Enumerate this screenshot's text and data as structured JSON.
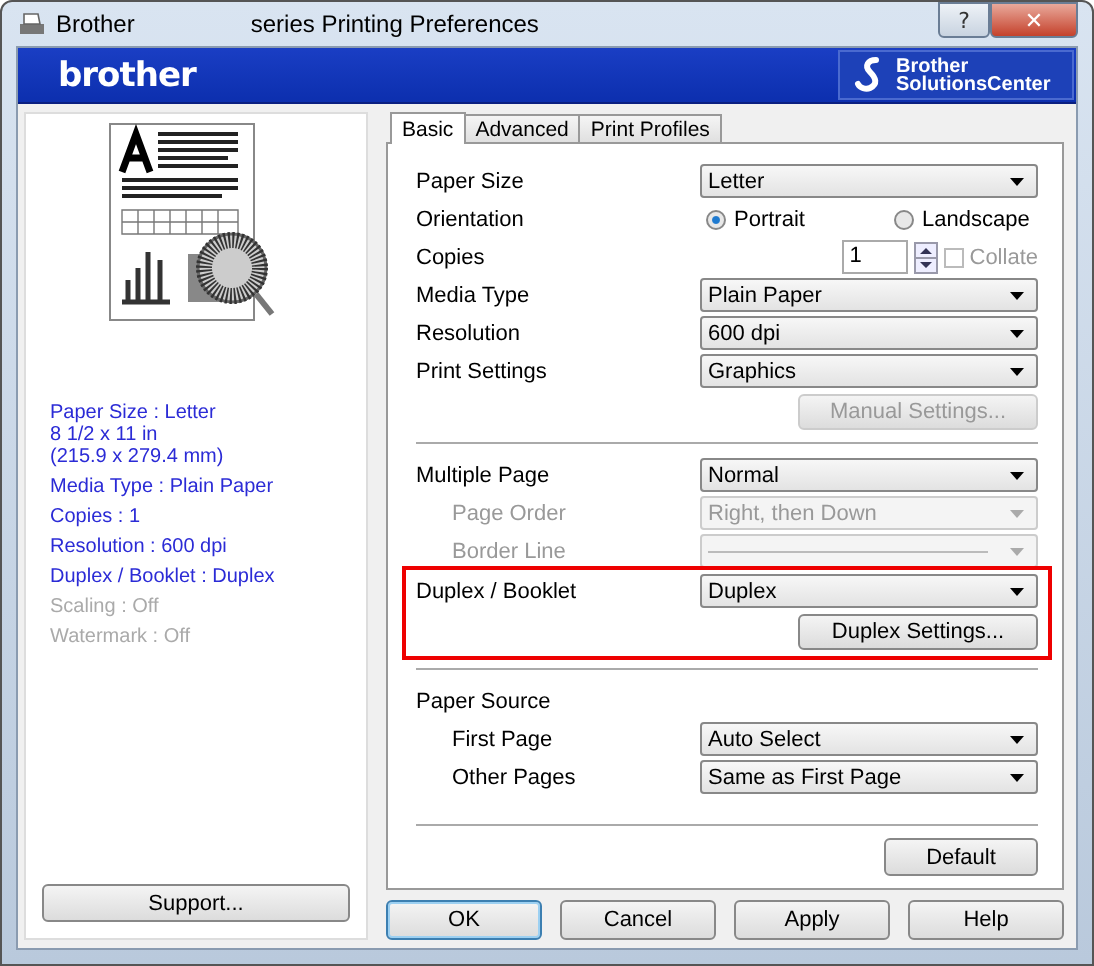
{
  "window": {
    "title_start": "Brother",
    "title_end": "series Printing Preferences",
    "help_glyph": "?",
    "close_glyph": "✕"
  },
  "banner": {
    "logo": "brother",
    "solutions_lines": [
      "Brother",
      "SolutionsCenter"
    ]
  },
  "summary": [
    {
      "lines": [
        "Paper Size : Letter",
        "8 1/2 x 11 in",
        "(215.9 x 279.4 mm)"
      ],
      "disabled": false
    },
    {
      "lines": [
        "Media Type : Plain Paper"
      ],
      "disabled": false
    },
    {
      "lines": [
        "Copies : 1"
      ],
      "disabled": false
    },
    {
      "lines": [
        "Resolution : 600 dpi"
      ],
      "disabled": false
    },
    {
      "lines": [
        "Duplex / Booklet : Duplex"
      ],
      "disabled": false
    },
    {
      "lines": [
        "Scaling : Off"
      ],
      "disabled": true
    },
    {
      "lines": [
        "Watermark : Off"
      ],
      "disabled": true
    }
  ],
  "support_button": "Support...",
  "tabs": [
    {
      "label": "Basic",
      "selected": true
    },
    {
      "label": "Advanced",
      "selected": false
    },
    {
      "label": "Print Profiles",
      "selected": false
    }
  ],
  "sections": [
    {
      "rows": [
        {
          "kind": "select",
          "label": "Paper Size",
          "value": "Letter",
          "disabled": false,
          "highlighted": false
        },
        {
          "kind": "radio",
          "label": "Orientation",
          "options": [
            {
              "label": "Portrait",
              "selected": true
            },
            {
              "label": "Landscape",
              "selected": false
            }
          ],
          "disabled": false,
          "highlighted": false
        },
        {
          "kind": "spinner",
          "label": "Copies",
          "value": "1",
          "collate": {
            "label": "Collate",
            "checked": false,
            "disabled": true
          },
          "disabled": false,
          "highlighted": false
        },
        {
          "kind": "select",
          "label": "Media Type",
          "value": "Plain Paper",
          "disabled": false,
          "highlighted": false
        },
        {
          "kind": "select",
          "label": "Resolution",
          "value": "600 dpi",
          "disabled": false,
          "highlighted": false
        },
        {
          "kind": "select",
          "label": "Print Settings",
          "value": "Graphics",
          "button": {
            "label": "Manual Settings...",
            "disabled": true
          },
          "disabled": false,
          "highlighted": false
        }
      ]
    },
    {
      "rows": [
        {
          "kind": "select",
          "label": "Multiple Page",
          "value": "Normal",
          "disabled": false,
          "highlighted": false,
          "children": [
            {
              "kind": "select",
              "label": "Page Order",
              "value": "Right, then Down",
              "disabled": true,
              "highlighted": false
            },
            {
              "kind": "line_select",
              "label": "Border Line",
              "disabled": true,
              "highlighted": false
            }
          ]
        },
        {
          "kind": "select",
          "label": "Duplex / Booklet",
          "value": "Duplex",
          "button": {
            "label": "Duplex Settings...",
            "disabled": false
          },
          "disabled": false,
          "highlighted": true
        }
      ]
    },
    {
      "rows": [
        {
          "kind": "heading",
          "label": "Paper Source",
          "disabled": false,
          "highlighted": false,
          "children": [
            {
              "kind": "select",
              "label": "First Page",
              "value": "Auto Select",
              "disabled": false,
              "highlighted": false
            },
            {
              "kind": "select",
              "label": "Other Pages",
              "value": "Same as First Page",
              "disabled": false,
              "highlighted": false
            }
          ]
        }
      ]
    }
  ],
  "default_button": "Default",
  "footer_buttons": [
    {
      "label": "OK",
      "focused": true
    },
    {
      "label": "Cancel",
      "focused": false
    },
    {
      "label": "Apply",
      "focused": false
    },
    {
      "label": "Help",
      "focused": false
    }
  ]
}
